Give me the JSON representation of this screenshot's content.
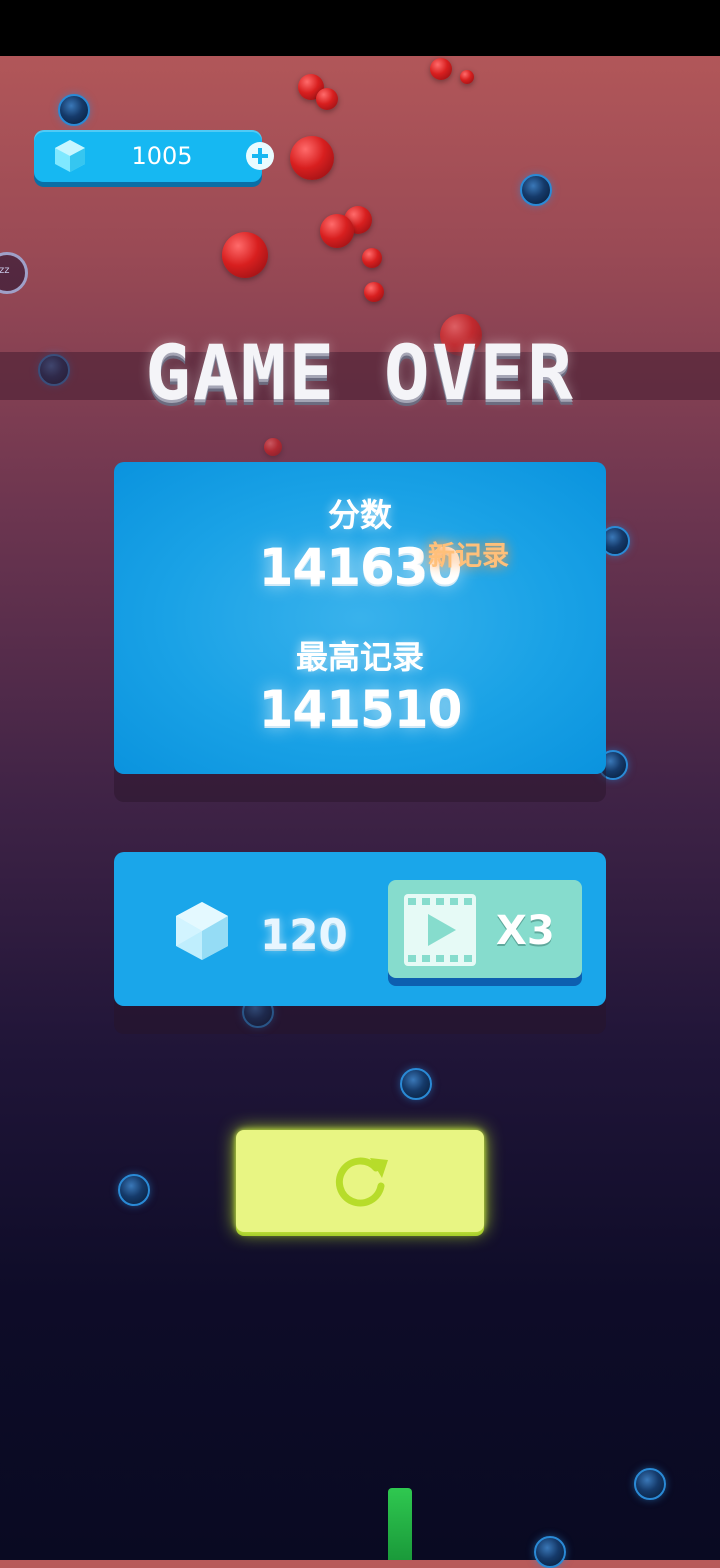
{
  "currency": {
    "gems": "1005",
    "gem_icon": "gem-icon",
    "add_icon": "plus-icon"
  },
  "side_badge": {
    "text": "zz"
  },
  "title": "GAME OVER",
  "score_panel": {
    "score_label": "分数",
    "score": "141630",
    "new_record_label": "新记录",
    "best_label": "最高记录",
    "best": "141510"
  },
  "reward": {
    "gem_icon": "gem-icon",
    "amount": "120",
    "video_icon": "video-play-icon",
    "multiplier": "X3"
  },
  "restart": {
    "icon": "restart-icon"
  },
  "colors": {
    "panel_blue": "#1aa6ea",
    "restart_yellow": "#e8f583",
    "video_teal": "#86dccd",
    "new_record_orange": "#ffc07a"
  }
}
